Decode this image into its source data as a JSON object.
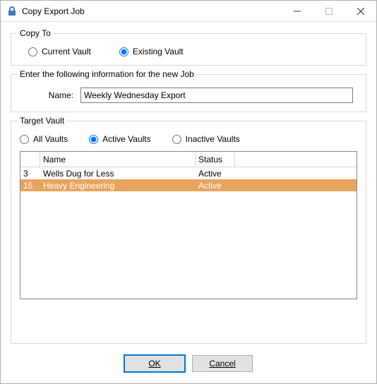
{
  "window": {
    "title": "Copy Export Job"
  },
  "copy_to": {
    "legend": "Copy To",
    "current_label": "Current Vault",
    "existing_label": "Existing Vault",
    "selected": "existing"
  },
  "job_info": {
    "legend": "Enter the following information for the new Job",
    "name_label": "Name:",
    "name_value": "Weekly Wednesday Export"
  },
  "target_vault": {
    "legend": "Target Vault",
    "all_label": "All Vaults",
    "active_label": "Active Vaults",
    "inactive_label": "Inactive Vaults",
    "selected": "active",
    "columns": {
      "id": "",
      "name": "Name",
      "status": "Status"
    },
    "rows": [
      {
        "id": "3",
        "name": "Wells Dug for Less",
        "status": "Active",
        "selected": false
      },
      {
        "id": "15",
        "name": "Heavy Engineering",
        "status": "Active",
        "selected": true
      }
    ]
  },
  "buttons": {
    "ok": "OK",
    "cancel": "Cancel"
  }
}
